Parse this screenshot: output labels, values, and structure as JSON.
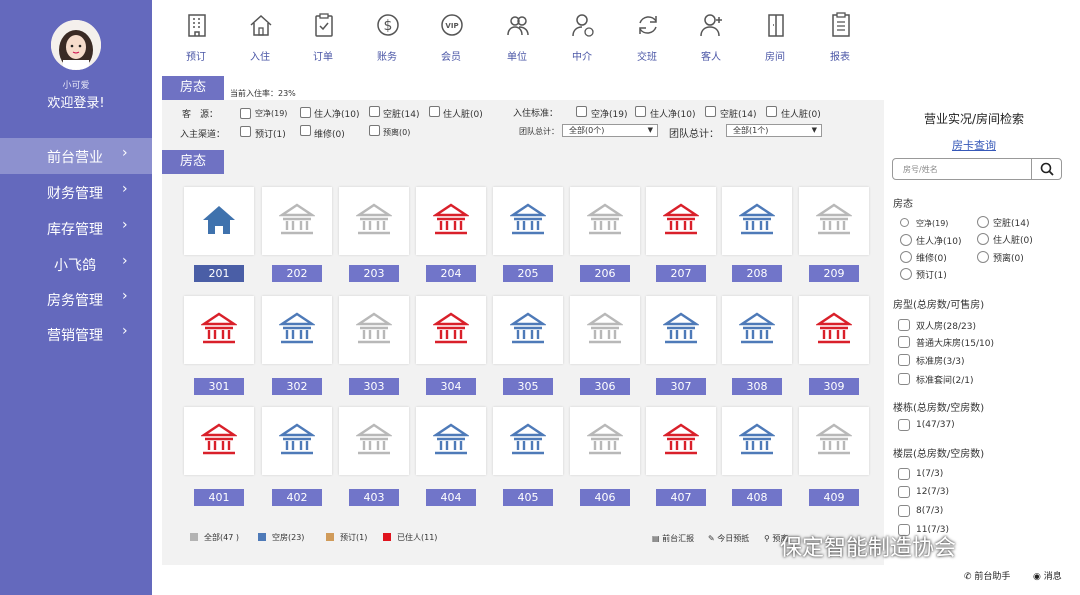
{
  "sidebar": {
    "username": "小可爱",
    "welcome": "欢迎登录!",
    "items": [
      {
        "label": "前台营业",
        "active": true
      },
      {
        "label": "财务管理"
      },
      {
        "label": "库存管理"
      },
      {
        "label": "小飞鸽"
      },
      {
        "label": "房务管理"
      },
      {
        "label": "营销管理"
      }
    ],
    "chevron": "›"
  },
  "toolbar": [
    {
      "label": "预订",
      "icon": "building-icon"
    },
    {
      "label": "入住",
      "icon": "home-icon"
    },
    {
      "label": "订单",
      "icon": "clipboard-check-icon"
    },
    {
      "label": "账务",
      "icon": "dollar-icon"
    },
    {
      "label": "会员",
      "icon": "vip-icon"
    },
    {
      "label": "单位",
      "icon": "group-icon"
    },
    {
      "label": "中介",
      "icon": "agent-icon"
    },
    {
      "label": "交班",
      "icon": "refresh-icon"
    },
    {
      "label": "客人",
      "icon": "add-user-icon"
    },
    {
      "label": "房间",
      "icon": "door-icon"
    },
    {
      "label": "报表",
      "icon": "report-icon"
    }
  ],
  "tabs": {
    "top": "房态",
    "mid": "房态"
  },
  "occupancy": "当前入住率：23%",
  "filters": {
    "source_label": "客　源：",
    "source_opts": [
      "空净(19)",
      "住人净(10)",
      "空脏(14)",
      "住人脏(0)"
    ],
    "channel_label": "入主渠道：",
    "channel_opts": [
      "预订(1)",
      "维修(0)",
      "预离(0)"
    ],
    "standard_label": "入住标准：",
    "standard_opts": [
      "空净(19)",
      "住人净(10)",
      "空脏(14)",
      "住人脏(0)"
    ],
    "team_total_label": "团队总计：",
    "team_total_value": "全部(0个)",
    "team_count_label": "团队总计：",
    "team_count_value": "全部(1个)"
  },
  "rooms": [
    [
      {
        "no": "201",
        "kind": "home"
      },
      {
        "no": "202",
        "kind": "gray"
      },
      {
        "no": "203",
        "kind": "gray"
      },
      {
        "no": "204",
        "kind": "red"
      },
      {
        "no": "205",
        "kind": "blue"
      },
      {
        "no": "206",
        "kind": "gray"
      },
      {
        "no": "207",
        "kind": "red"
      },
      {
        "no": "208",
        "kind": "blue"
      },
      {
        "no": "209",
        "kind": "gray"
      }
    ],
    [
      {
        "no": "301",
        "kind": "red"
      },
      {
        "no": "302",
        "kind": "blue"
      },
      {
        "no": "303",
        "kind": "gray"
      },
      {
        "no": "304",
        "kind": "red"
      },
      {
        "no": "305",
        "kind": "blue"
      },
      {
        "no": "306",
        "kind": "gray"
      },
      {
        "no": "307",
        "kind": "blue"
      },
      {
        "no": "308",
        "kind": "blue"
      },
      {
        "no": "309",
        "kind": "red"
      }
    ],
    [
      {
        "no": "401",
        "kind": "red"
      },
      {
        "no": "402",
        "kind": "blue"
      },
      {
        "no": "403",
        "kind": "gray"
      },
      {
        "no": "404",
        "kind": "blue"
      },
      {
        "no": "405",
        "kind": "blue"
      },
      {
        "no": "406",
        "kind": "gray"
      },
      {
        "no": "407",
        "kind": "red"
      },
      {
        "no": "408",
        "kind": "blue"
      },
      {
        "no": "409",
        "kind": "gray"
      }
    ]
  ],
  "colors": {
    "gray": "#b8b8b8",
    "blue": "#4e7ab8",
    "red": "#d9202a",
    "home": "#3f72ad",
    "accent": "#6469bd"
  },
  "legend": [
    {
      "label": "全部(47 )",
      "color": "#b3b3b3"
    },
    {
      "label": "空房(23)",
      "color": "#4e7ab8"
    },
    {
      "label": "预订(1)",
      "color": "#d09b5a"
    },
    {
      "label": "已住人(11)",
      "color": "#e0141e"
    }
  ],
  "bottom_actions": [
    "前台汇报",
    "今日预抵",
    "预离"
  ],
  "right": {
    "title": "营业实况/房间检索",
    "link": "房卡查询",
    "search_placeholder": "房号/姓名",
    "status_heading": "房态",
    "status_opts": [
      "空净(19)",
      "空脏(14)",
      "住人净(10)",
      "住人脏(0)",
      "维修(0)",
      "预离(0)",
      "预订(1)"
    ],
    "type_heading": "房型(总房数/可售房)",
    "type_opts": [
      "双人房(28/23)",
      "普通大床房(15/10)",
      "标准房(3/3)",
      "标准套间(2/1)"
    ],
    "building_heading": "楼栋(总房数/空房数)",
    "building_opts": [
      "1(47/37)"
    ],
    "floor_heading": "楼层(总房数/空房数)",
    "floor_opts": [
      "1(7/3)",
      "12(7/3)",
      "8(7/3)",
      "11(7/3)"
    ]
  },
  "footer": {
    "assistant": "前台助手",
    "messages": "消息"
  },
  "watermark": "保定智能制造协会"
}
